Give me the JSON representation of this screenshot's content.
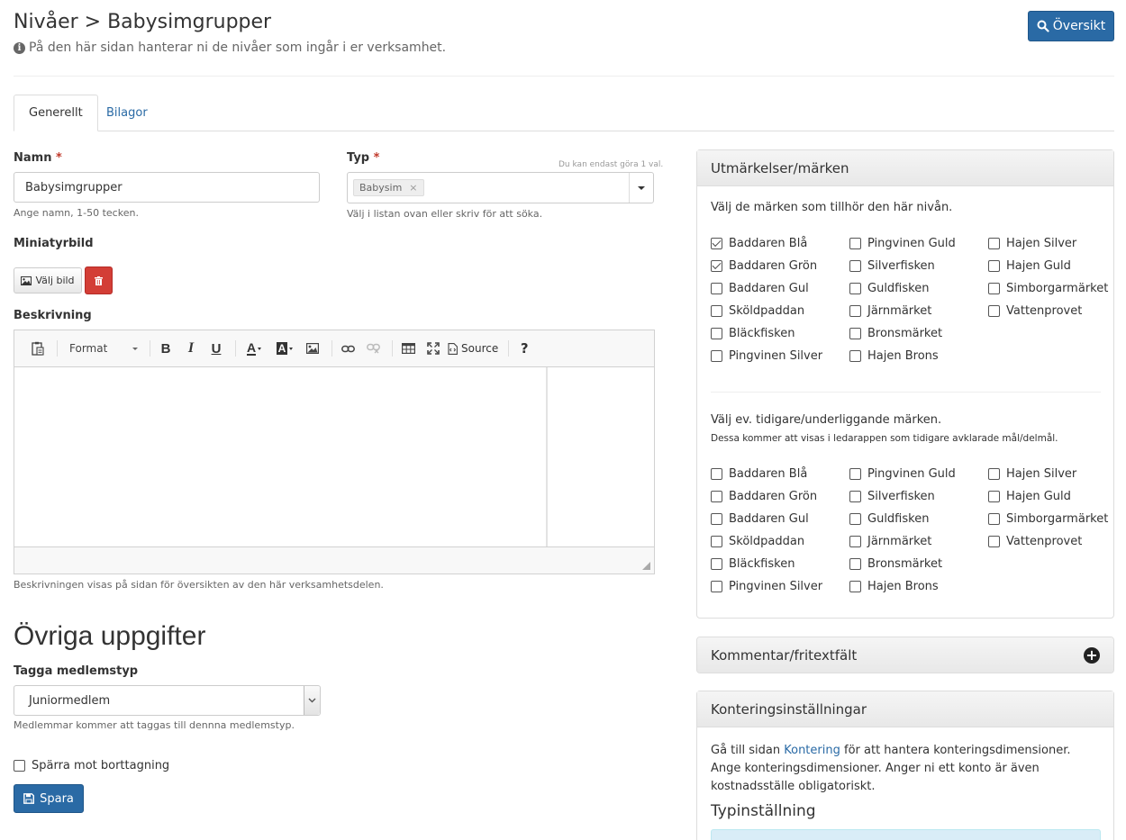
{
  "header": {
    "title": "Nivåer > Babysimgrupper",
    "subtitle": "På den här sidan hanterar ni de nivåer som ingår i er verksamhet.",
    "overview_button": "Översikt"
  },
  "tabs": [
    {
      "label": "Generellt",
      "active": true
    },
    {
      "label": "Bilagor",
      "active": false
    }
  ],
  "form": {
    "name": {
      "label": "Namn",
      "required_mark": "*",
      "value": "Babysimgrupper",
      "help": "Ange namn, 1-50 tecken."
    },
    "type": {
      "label": "Typ",
      "required_mark": "*",
      "limit_note": "Du kan endast göra 1 val.",
      "selected_tag": "Babysim",
      "tag_remove": "×",
      "help": "Välj i listan ovan eller skriv för att söka."
    },
    "thumbnail": {
      "label": "Miniatyrbild",
      "choose_button": "Välj bild"
    },
    "description": {
      "label": "Beskrivning",
      "toolbar": {
        "format_label": "Format",
        "source_label": "Source"
      },
      "help": "Beskrivningen visas på sidan för översikten av den här verksamhetsdelen."
    },
    "other_heading": "Övriga uppgifter",
    "member_type": {
      "label": "Tagga medlemstyp",
      "value": "Juniormedlem",
      "help": "Medlemmar kommer att taggas till dennna medlemstyp."
    },
    "lock_delete": {
      "label": "Spärra mot borttagning",
      "checked": false
    },
    "save_button": "Spara"
  },
  "badges_panel": {
    "title": "Utmärkelser/märken",
    "intro": "Välj de märken som tillhör den här nivån.",
    "badges": [
      {
        "label": "Baddaren Blå",
        "checked": true
      },
      {
        "label": "Baddaren Grön",
        "checked": true
      },
      {
        "label": "Baddaren Gul",
        "checked": false
      },
      {
        "label": "Sköldpaddan",
        "checked": false
      },
      {
        "label": "Bläckfisken",
        "checked": false
      },
      {
        "label": "Pingvinen Silver",
        "checked": false
      },
      {
        "label": "Pingvinen Guld",
        "checked": false
      },
      {
        "label": "Silverfisken",
        "checked": false
      },
      {
        "label": "Guldfisken",
        "checked": false
      },
      {
        "label": "Järnmärket",
        "checked": false
      },
      {
        "label": "Bronsmärket",
        "checked": false
      },
      {
        "label": "Hajen Brons",
        "checked": false
      },
      {
        "label": "Hajen Silver",
        "checked": false
      },
      {
        "label": "Hajen Guld",
        "checked": false
      },
      {
        "label": "Simborgarmärket",
        "checked": false
      },
      {
        "label": "Vattenprovet",
        "checked": false
      }
    ],
    "prev_intro": "Välj ev. tidigare/underliggande märken.",
    "prev_note": "Dessa kommer att visas i ledarappen som tidigare avklarade mål/delmål.",
    "prev_badges": [
      {
        "label": "Baddaren Blå",
        "checked": false
      },
      {
        "label": "Baddaren Grön",
        "checked": false
      },
      {
        "label": "Baddaren Gul",
        "checked": false
      },
      {
        "label": "Sköldpaddan",
        "checked": false
      },
      {
        "label": "Bläckfisken",
        "checked": false
      },
      {
        "label": "Pingvinen Silver",
        "checked": false
      },
      {
        "label": "Pingvinen Guld",
        "checked": false
      },
      {
        "label": "Silverfisken",
        "checked": false
      },
      {
        "label": "Guldfisken",
        "checked": false
      },
      {
        "label": "Järnmärket",
        "checked": false
      },
      {
        "label": "Bronsmärket",
        "checked": false
      },
      {
        "label": "Hajen Brons",
        "checked": false
      },
      {
        "label": "Hajen Silver",
        "checked": false
      },
      {
        "label": "Hajen Guld",
        "checked": false
      },
      {
        "label": "Simborgarmärket",
        "checked": false
      },
      {
        "label": "Vattenprovet",
        "checked": false
      }
    ]
  },
  "comment_panel": {
    "title": "Kommentar/fritextfält"
  },
  "accounting_panel": {
    "title": "Konteringsinställningar",
    "line1_prefix": "Gå till sidan",
    "line1_link": "Kontering",
    "line1_suffix": "för att hantera konteringsdimensioner.",
    "line2": "Ange konteringsdimensioner. Anger ni ett konto är även kostnadsställe obligatoriskt.",
    "type_heading": "Typinställning"
  },
  "colors": {
    "primary": "#2a6aa5",
    "danger": "#d33e36",
    "required": "#c0392b",
    "info_box": "#d9edf7"
  }
}
